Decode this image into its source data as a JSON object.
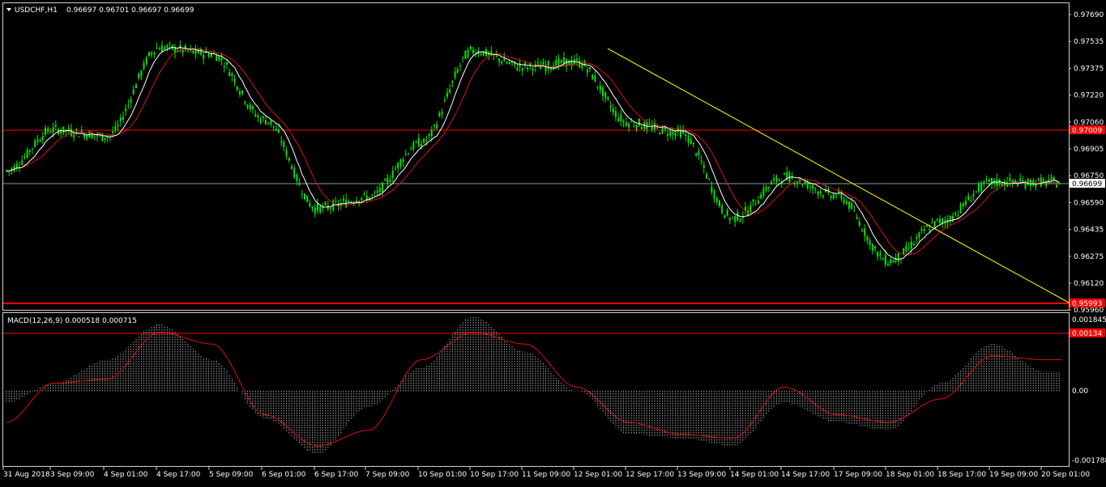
{
  "main_panel": {
    "title": "USDCHF,H1",
    "ohlc": "0.96697 0.96701 0.96697 0.96699",
    "price_ticks": [
      "0.97690",
      "0.97535",
      "0.97375",
      "0.97220",
      "0.97060",
      "0.96905",
      "0.96750",
      "0.96590",
      "0.96435",
      "0.96275",
      "0.96120",
      "0.95960"
    ],
    "level_labels": {
      "upper": "0.97009",
      "current": "0.96699",
      "lower": "0.95993"
    }
  },
  "macd_panel": {
    "title": "MACD(12,26,9) 0.000518 0.000715",
    "ticks": [
      "0.001845",
      "0.00",
      "-0.001788"
    ],
    "level_label": "0.00134"
  },
  "time_axis": {
    "labels": [
      "31 Aug 2018",
      "3 Sep 09:00",
      "4 Sep 01:00",
      "4 Sep 17:00",
      "5 Sep 09:00",
      "6 Sep 01:00",
      "6 Sep 17:00",
      "7 Sep 09:00",
      "10 Sep 01:00",
      "10 Sep 17:00",
      "11 Sep 09:00",
      "12 Sep 01:00",
      "12 Sep 17:00",
      "13 Sep 09:00",
      "14 Sep 01:00",
      "14 Sep 17:00",
      "17 Sep 09:00",
      "18 Sep 01:00",
      "18 Sep 17:00",
      "19 Sep 09:00",
      "20 Sep 01:00"
    ]
  },
  "colors": {
    "candle": "#00e600",
    "fast_ma": "#ffffff",
    "slow_ma": "#e01010",
    "trendline": "#ffff00",
    "level_line": "#ff0000",
    "current_price_line": "#8a9aaa",
    "histogram": "#ffffff",
    "signal_line": "#e01010",
    "frame": "#d0d0d0",
    "label_bg_red": "#ff0000"
  },
  "chart_data": [
    {
      "type": "candlestick",
      "title": "USDCHF,H1",
      "ylim": [
        0.9593,
        0.9772
      ],
      "series": [
        {
          "name": "price",
          "anchors": [
            [
              "31 Aug 2018",
              0.9677
            ],
            [
              "3 Sep 09:00",
              0.9702
            ],
            [
              "4 Sep 01:00",
              0.9698
            ],
            [
              "4 Sep 17:00",
              0.9752
            ],
            [
              "5 Sep 09:00",
              0.9748
            ],
            [
              "6 Sep 01:00",
              0.9708
            ],
            [
              "6 Sep 17:00",
              0.9654
            ],
            [
              "7 Sep 09:00",
              0.9661
            ],
            [
              "10 Sep 01:00",
              0.9694
            ],
            [
              "10 Sep 17:00",
              0.975
            ],
            [
              "11 Sep 09:00",
              0.974
            ],
            [
              "12 Sep 01:00",
              0.9743
            ],
            [
              "12 Sep 17:00",
              0.9706
            ],
            [
              "13 Sep 09:00",
              0.97
            ],
            [
              "14 Sep 01:00",
              0.9648
            ],
            [
              "14 Sep 17:00",
              0.9673
            ],
            [
              "17 Sep 09:00",
              0.9662
            ],
            [
              "18 Sep 01:00",
              0.9622
            ],
            [
              "18 Sep 17:00",
              0.9646
            ],
            [
              "19 Sep 09:00",
              0.967
            ],
            [
              "20 Sep 01:00",
              0.967
            ]
          ]
        }
      ],
      "levels": [
        0.97009,
        0.96699,
        0.95993
      ]
    },
    {
      "type": "histogram",
      "title": "MACD(12,26,9) 0.000518 0.000715",
      "ylim": [
        -0.001788,
        0.001845
      ],
      "series": [
        {
          "name": "histogram",
          "anchors": [
            [
              "31 Aug 2018",
              -0.0003
            ],
            [
              "3 Sep 09:00",
              0.0002
            ],
            [
              "4 Sep 01:00",
              0.0008
            ],
            [
              "4 Sep 17:00",
              0.0017
            ],
            [
              "5 Sep 09:00",
              0.0008
            ],
            [
              "6 Sep 01:00",
              -0.0007
            ],
            [
              "6 Sep 17:00",
              -0.0016
            ],
            [
              "7 Sep 09:00",
              -0.0004
            ],
            [
              "10 Sep 01:00",
              0.0006
            ],
            [
              "10 Sep 17:00",
              0.0019
            ],
            [
              "11 Sep 09:00",
              0.001
            ],
            [
              "12 Sep 01:00",
              0.0
            ],
            [
              "12 Sep 17:00",
              -0.0011
            ],
            [
              "13 Sep 09:00",
              -0.0012
            ],
            [
              "14 Sep 01:00",
              -0.0014
            ],
            [
              "14 Sep 17:00",
              -0.0003
            ],
            [
              "17 Sep 09:00",
              -0.0008
            ],
            [
              "18 Sep 01:00",
              -0.001
            ],
            [
              "18 Sep 17:00",
              0.0002
            ],
            [
              "19 Sep 09:00",
              0.0012
            ],
            [
              "20 Sep 01:00",
              0.0005
            ]
          ]
        },
        {
          "name": "signal",
          "anchors": [
            [
              "31 Aug 2018",
              -0.0008
            ],
            [
              "3 Sep 09:00",
              0.0002
            ],
            [
              "4 Sep 01:00",
              0.0003
            ],
            [
              "4 Sep 17:00",
              0.0015
            ],
            [
              "5 Sep 09:00",
              0.0012
            ],
            [
              "6 Sep 01:00",
              -0.0006
            ],
            [
              "6 Sep 17:00",
              -0.0014
            ],
            [
              "7 Sep 09:00",
              -0.001
            ],
            [
              "10 Sep 01:00",
              0.0008
            ],
            [
              "10 Sep 17:00",
              0.0015
            ],
            [
              "11 Sep 09:00",
              0.0012
            ],
            [
              "12 Sep 01:00",
              0.0001
            ],
            [
              "12 Sep 17:00",
              -0.0008
            ],
            [
              "13 Sep 09:00",
              -0.0011
            ],
            [
              "14 Sep 01:00",
              -0.0012
            ],
            [
              "14 Sep 17:00",
              0.0001
            ],
            [
              "17 Sep 09:00",
              -0.0006
            ],
            [
              "18 Sep 01:00",
              -0.0008
            ],
            [
              "18 Sep 17:00",
              -0.0002
            ],
            [
              "19 Sep 09:00",
              0.0009
            ],
            [
              "20 Sep 01:00",
              0.0008
            ]
          ]
        }
      ],
      "levels": [
        0.00134
      ]
    }
  ]
}
